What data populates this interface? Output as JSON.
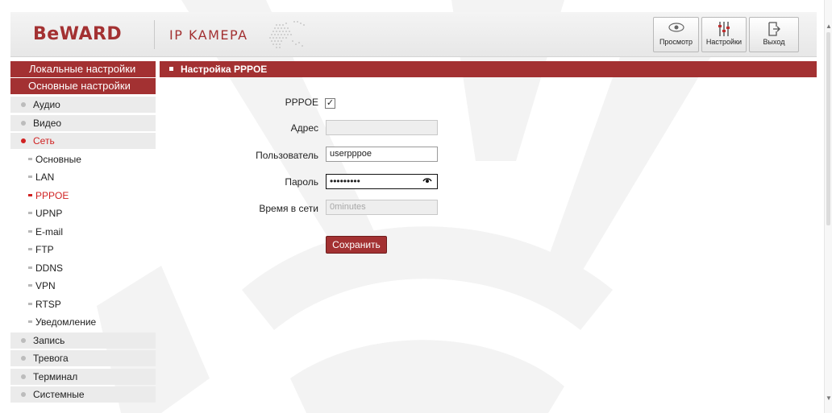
{
  "header": {
    "logo": "BeWARD",
    "subtitle": "IP KAMEPA",
    "buttons": [
      {
        "label": "Просмотр",
        "icon": "eye-icon"
      },
      {
        "label": "Настройки",
        "icon": "sliders-icon"
      },
      {
        "label": "Выход",
        "icon": "exit-icon"
      }
    ]
  },
  "sidebar": {
    "local_settings": "Локальные настройки",
    "main_settings": "Основные настройки",
    "items": [
      {
        "label": "Аудио"
      },
      {
        "label": "Видео"
      },
      {
        "label": "Сеть"
      }
    ],
    "network_sub": [
      {
        "label": "Основные"
      },
      {
        "label": "LAN"
      },
      {
        "label": "PPPOE"
      },
      {
        "label": "UPNP"
      },
      {
        "label": "E-mail"
      },
      {
        "label": "FTP"
      },
      {
        "label": "DDNS"
      },
      {
        "label": "VPN"
      },
      {
        "label": "RTSP"
      },
      {
        "label": "Уведомление"
      }
    ],
    "items_after": [
      {
        "label": "Запись"
      },
      {
        "label": "Тревога"
      },
      {
        "label": "Терминал"
      },
      {
        "label": "Системные"
      }
    ]
  },
  "main": {
    "title": "Настройка PPPOE",
    "form": {
      "pppoe_label": "PPPOE",
      "pppoe_checked": true,
      "pppoe_mark": "✓",
      "address_label": "Адрес",
      "address_value": "",
      "user_label": "Пользователь",
      "user_value": "userpppoe",
      "password_label": "Пароль",
      "password_value": "•••••••••",
      "online_label": "Время в сети",
      "online_value": "0minutes",
      "save_label": "Сохранить"
    }
  },
  "colors": {
    "brand": "#a33132",
    "active_item": "#d02222"
  }
}
